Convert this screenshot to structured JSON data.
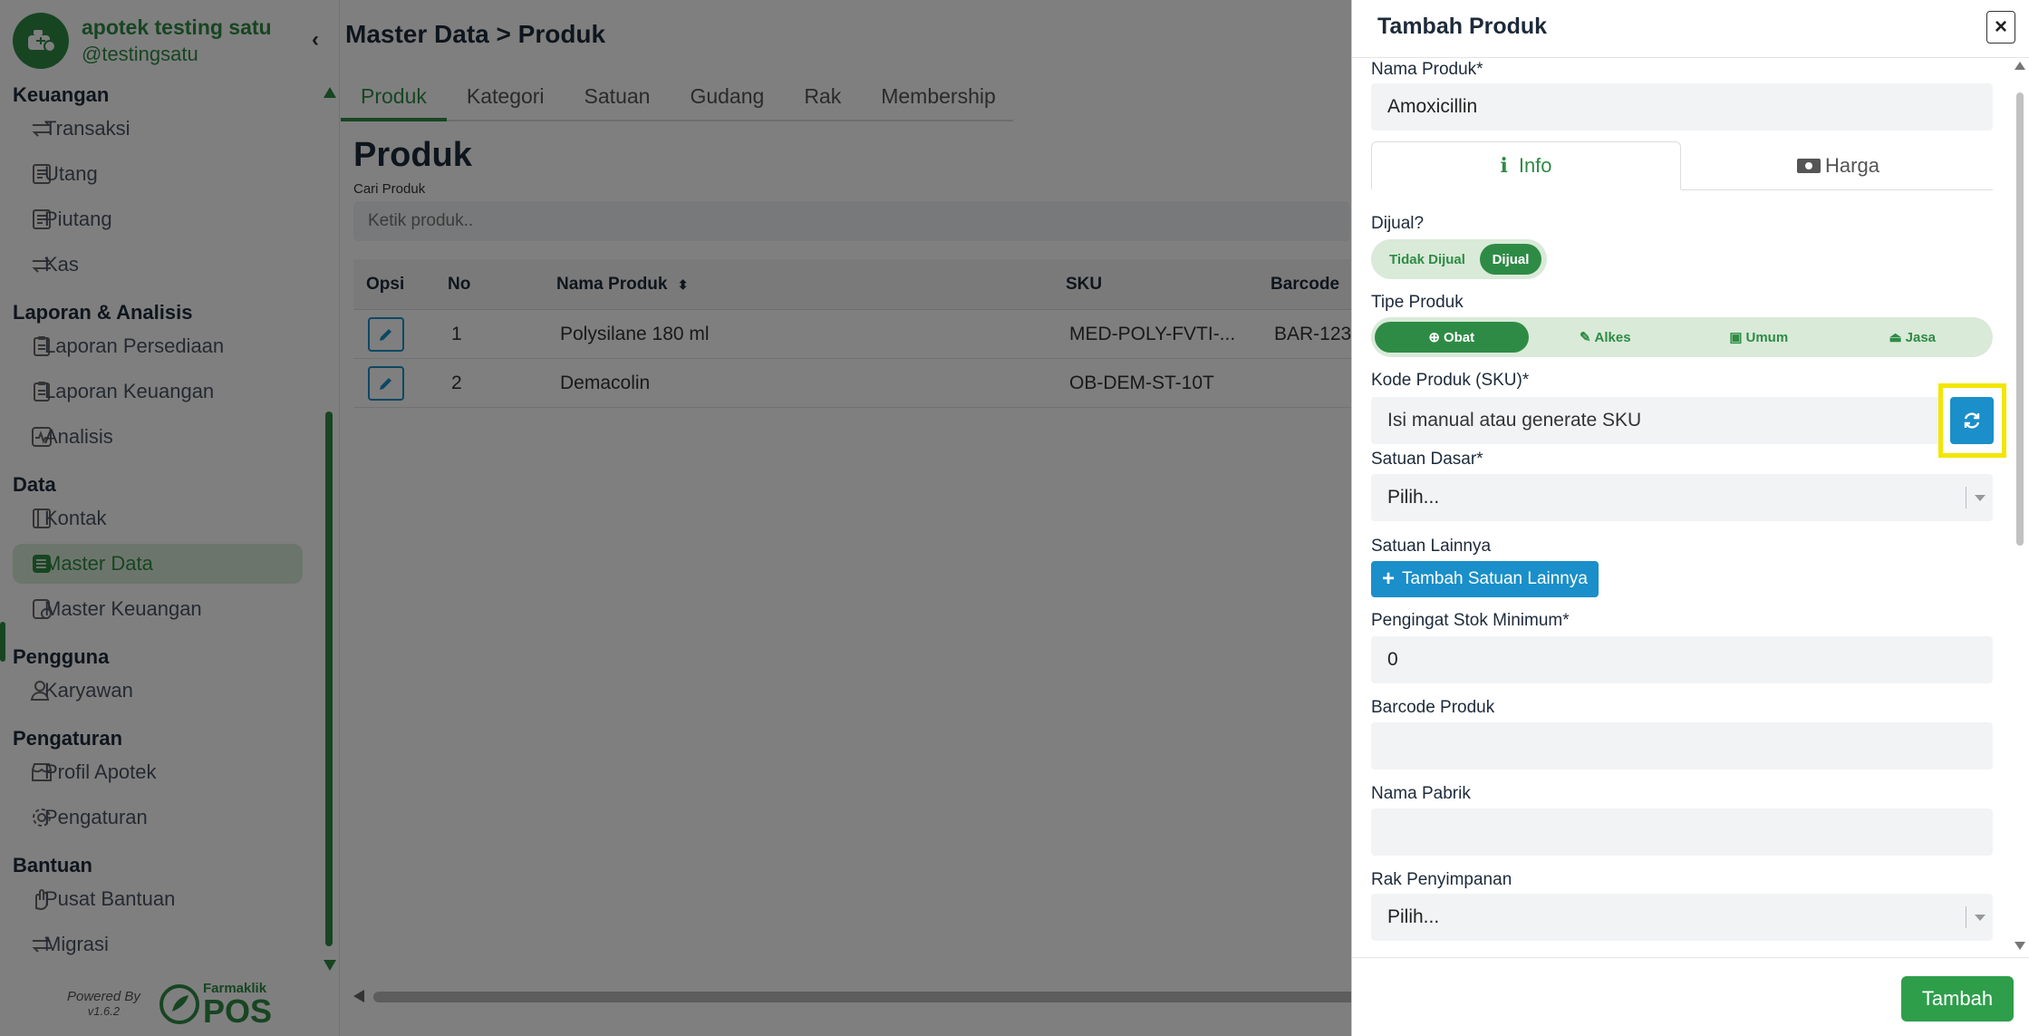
{
  "brand": {
    "name": "apotek testing satu",
    "handle": "@testingsatu"
  },
  "sidebar": {
    "sections": [
      {
        "title": "Keuangan",
        "items": [
          {
            "label": "Transaksi"
          },
          {
            "label": "Utang"
          },
          {
            "label": "Piutang"
          },
          {
            "label": "Kas"
          }
        ]
      },
      {
        "title": "Laporan & Analisis",
        "items": [
          {
            "label": "Laporan Persediaan"
          },
          {
            "label": "Laporan Keuangan"
          },
          {
            "label": "Analisis"
          }
        ]
      },
      {
        "title": "Data",
        "items": [
          {
            "label": "Kontak"
          },
          {
            "label": "Master Data"
          },
          {
            "label": "Master Keuangan"
          }
        ]
      },
      {
        "title": "Pengguna",
        "items": [
          {
            "label": "Karyawan"
          }
        ]
      },
      {
        "title": "Pengaturan",
        "items": [
          {
            "label": "Profil Apotek"
          },
          {
            "label": "Pengaturan"
          }
        ]
      },
      {
        "title": "Bantuan",
        "items": [
          {
            "label": "Pusat Bantuan"
          },
          {
            "label": "Migrasi"
          }
        ]
      }
    ],
    "active_item": "Master Data",
    "powered_by": "Powered By",
    "version": "v1.6.2",
    "powered_logo_small": "Farmaklik",
    "powered_logo_big": "POS"
  },
  "main": {
    "breadcrumb": "Master Data > Produk",
    "tabs": [
      {
        "label": "Produk"
      },
      {
        "label": "Kategori"
      },
      {
        "label": "Satuan"
      },
      {
        "label": "Gudang"
      },
      {
        "label": "Rak"
      },
      {
        "label": "Membership"
      }
    ],
    "active_tab": "Produk",
    "section_title": "Produk",
    "search": {
      "label": "Cari Produk",
      "placeholder": "Ketik produk.."
    },
    "table": {
      "headers": {
        "opsi": "Opsi",
        "no": "No",
        "nama": "Nama Produk",
        "sku": "SKU",
        "barcode": "Barcode"
      },
      "rows": [
        {
          "no": "1",
          "nama": "Polysilane 180 ml",
          "sku": "MED-POLY-FVTI-...",
          "barcode": "BAR-123"
        },
        {
          "no": "2",
          "nama": "Demacolin",
          "sku": "OB-DEM-ST-10T",
          "barcode": ""
        }
      ]
    }
  },
  "modal": {
    "title": "Tambah Produk",
    "close_label": "×",
    "nama_produk": {
      "label": "Nama Produk*",
      "value": "Amoxicillin"
    },
    "tabs": [
      {
        "label": "Info"
      },
      {
        "label": "Harga"
      }
    ],
    "dijual": {
      "label": "Dijual?",
      "options": [
        "Tidak Dijual",
        "Dijual"
      ],
      "selected": "Dijual"
    },
    "tipe_produk": {
      "label": "Tipe Produk",
      "options": [
        "Obat",
        "Alkes",
        "Umum",
        "Jasa"
      ],
      "selected": "Obat"
    },
    "sku": {
      "label": "Kode Produk (SKU)*",
      "placeholder": "Isi manual atau generate SKU"
    },
    "satuan_dasar": {
      "label": "Satuan Dasar*",
      "value": "Pilih..."
    },
    "satuan_lainnya": {
      "label": "Satuan Lainnya",
      "button": "Tambah Satuan Lainnya"
    },
    "stok_minimum": {
      "label": "Pengingat Stok Minimum*",
      "value": "0"
    },
    "barcode": {
      "label": "Barcode Produk",
      "value": ""
    },
    "pabrik": {
      "label": "Nama Pabrik",
      "value": ""
    },
    "rak": {
      "label": "Rak Penyimpanan",
      "value": "Pilih..."
    },
    "submit_label": "Tambah"
  },
  "colors": {
    "brand_green": "#2e8b45",
    "action_blue": "#1a8fc9",
    "highlight_yellow": "#f2e600"
  }
}
